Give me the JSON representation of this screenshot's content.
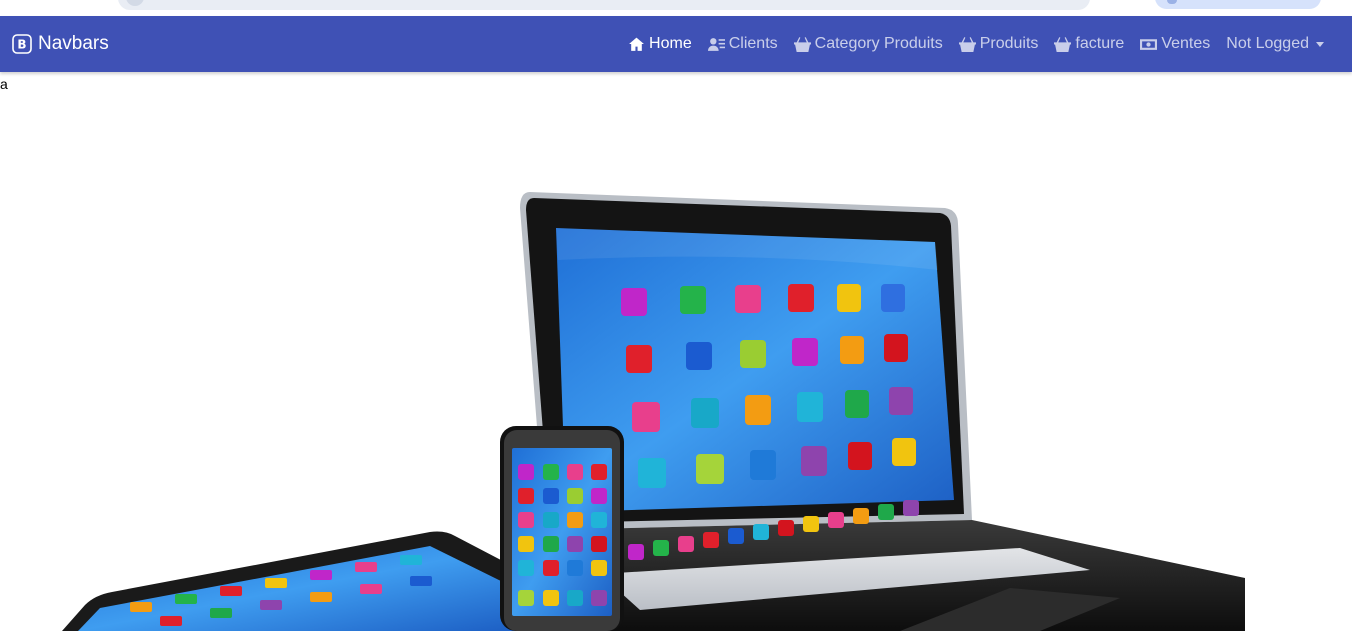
{
  "navbar": {
    "brand": "Navbars",
    "brand_icon": "bootstrap-icon",
    "background": "#3f51b5",
    "items": [
      {
        "label": "Home",
        "icon": "house-icon",
        "active": true
      },
      {
        "label": "Clients",
        "icon": "person-lines-icon",
        "active": false
      },
      {
        "label": "Category Produits",
        "icon": "basket-icon",
        "active": false
      },
      {
        "label": "Produits",
        "icon": "basket-icon",
        "active": false
      },
      {
        "label": "facture",
        "icon": "basket-icon",
        "active": false
      },
      {
        "label": "Ventes",
        "icon": "cash-icon",
        "active": false
      }
    ],
    "user_dropdown": "Not Logged"
  },
  "main": {
    "text": "a",
    "hero_image": "devices-illustration"
  }
}
